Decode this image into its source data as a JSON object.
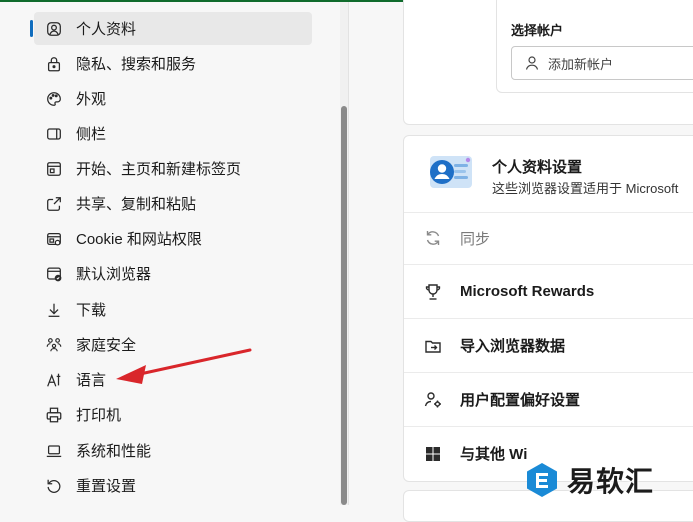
{
  "sidebar": {
    "items": [
      {
        "label": "个人资料",
        "icon": "profile-icon"
      },
      {
        "label": "隐私、搜索和服务",
        "icon": "lock-icon"
      },
      {
        "label": "外观",
        "icon": "palette-icon"
      },
      {
        "label": "侧栏",
        "icon": "sidebar-icon"
      },
      {
        "label": "开始、主页和新建标签页",
        "icon": "home-tab-icon"
      },
      {
        "label": "共享、复制和粘贴",
        "icon": "share-icon"
      },
      {
        "label": "Cookie 和网站权限",
        "icon": "cookie-icon"
      },
      {
        "label": "默认浏览器",
        "icon": "default-browser-icon"
      },
      {
        "label": "下载",
        "icon": "download-icon"
      },
      {
        "label": "家庭安全",
        "icon": "family-icon"
      },
      {
        "label": "语言",
        "icon": "language-icon"
      },
      {
        "label": "打印机",
        "icon": "printer-icon"
      },
      {
        "label": "系统和性能",
        "icon": "laptop-icon"
      },
      {
        "label": "重置设置",
        "icon": "reset-icon"
      }
    ],
    "active_index": 0
  },
  "account": {
    "title": "选择帐户",
    "add_label": "添加新帐户"
  },
  "profile_settings": {
    "title": "个人资料设置",
    "description": "这些浏览器设置适用于 Microsoft",
    "rows": [
      {
        "label": "同步",
        "icon": "sync-icon",
        "disabled": true
      },
      {
        "label": "Microsoft Rewards",
        "icon": "trophy-icon"
      },
      {
        "label": "导入浏览器数据",
        "icon": "import-icon"
      },
      {
        "label": "用户配置偏好设置",
        "icon": "user-settings-icon"
      },
      {
        "label": "与其他 Wi",
        "icon": "windows-icon"
      }
    ]
  },
  "watermark": {
    "text": "易软汇"
  },
  "colors": {
    "accent": "#0f6cbd",
    "annotation_arrow": "#d9262b",
    "top_bar": "#0f6b2c"
  }
}
